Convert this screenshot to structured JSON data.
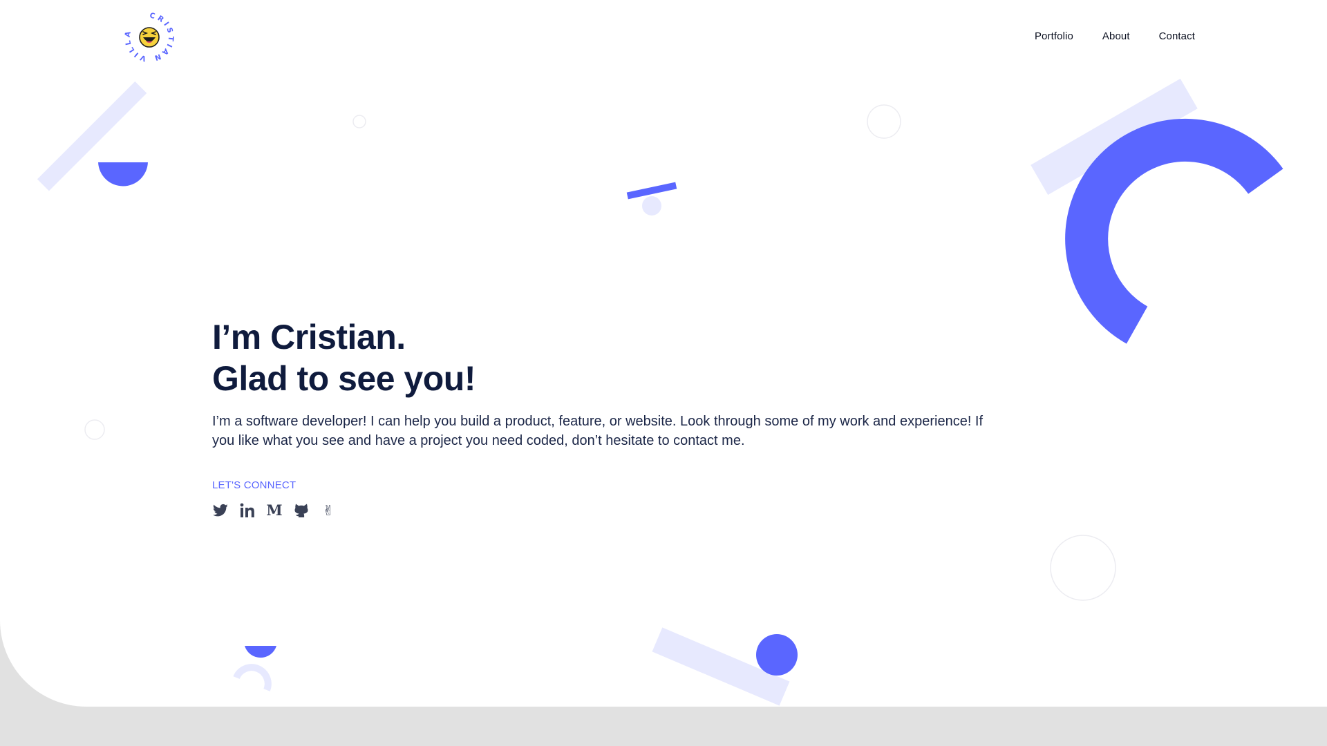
{
  "header": {
    "logo": {
      "text": "CRISTIAN VILLA",
      "icon": "laughing-face-icon"
    },
    "nav": [
      {
        "label": "Portfolio"
      },
      {
        "label": "About"
      },
      {
        "label": "Contact"
      }
    ]
  },
  "hero": {
    "title_line1": "I’m Cristian.",
    "title_line2": "Glad to see you!",
    "intro": "I’m a software developer! I can help you build a product, feature, or website. Look through some of my work and experience! If you like what you see and have a project you need coded, don’t hesitate to contact me.",
    "connect_label": "LET'S CONNECT",
    "social": [
      {
        "icon": "twitter-icon"
      },
      {
        "icon": "linkedin-icon"
      },
      {
        "icon": "medium-icon",
        "glyph": "M"
      },
      {
        "icon": "github-icon"
      },
      {
        "icon": "angellist-icon",
        "glyph": "✌"
      }
    ]
  },
  "colors": {
    "accent": "#5a66ff",
    "accent_light": "#e7e9fe",
    "heading": "#0f1b3d",
    "body_text": "#1b2647",
    "icon": "#3a4156",
    "footer_background": "#e1e1e1"
  }
}
